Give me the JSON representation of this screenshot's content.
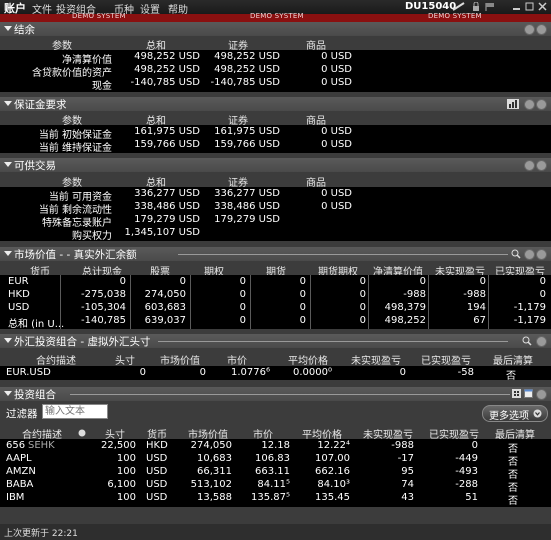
{
  "titlebar": {
    "title": "账户",
    "menu": [
      "文件",
      "投资组合",
      "币种",
      "设置",
      "帮助"
    ],
    "account": "DU15040"
  },
  "demo_labels": [
    "DEMO SYSTEM",
    "DEMO SYSTEM",
    "DEMO SYSTEM"
  ],
  "summary": {
    "title": "结余",
    "headers": [
      "参数",
      "总和",
      "证券",
      "商品"
    ],
    "rows": [
      [
        "净清算价值",
        "498,252 USD",
        "498,252 USD",
        "0 USD"
      ],
      [
        "含贷款价值的资产",
        "498,252 USD",
        "498,252 USD",
        "0 USD"
      ],
      [
        "现金",
        "-140,785 USD",
        "-140,785 USD",
        "0 USD"
      ]
    ]
  },
  "margin": {
    "title": "保证金要求",
    "headers": [
      "参数",
      "总和",
      "证券",
      "商品"
    ],
    "rows": [
      [
        "当前 初始保证金",
        "161,975 USD",
        "161,975 USD",
        "0 USD"
      ],
      [
        "当前 维持保证金",
        "159,766 USD",
        "159,766 USD",
        "0 USD"
      ]
    ]
  },
  "available": {
    "title": "可供交易",
    "headers": [
      "参数",
      "总和",
      "证券",
      "商品"
    ],
    "rows": [
      [
        "当前 可用资金",
        "336,277 USD",
        "336,277 USD",
        "0 USD"
      ],
      [
        "当前 剩余流动性",
        "338,486 USD",
        "338,486 USD",
        "0 USD"
      ],
      [
        "特殊备忘录账户",
        "179,279 USD",
        "179,279 USD",
        ""
      ],
      [
        "购买权力",
        "1,345,107 USD",
        "",
        ""
      ]
    ]
  },
  "market": {
    "title": "市场价值 - - 真实外汇余额",
    "headers": [
      "货币",
      "总计现金",
      "股票",
      "期权",
      "期货",
      "期货期权",
      "净清算价值",
      "未实现盈亏",
      "已实现盈亏"
    ],
    "rows": [
      [
        "EUR",
        "0",
        "0",
        "0",
        "0",
        "0",
        "0",
        "0",
        "0"
      ],
      [
        "HKD",
        "-275,038",
        "274,050",
        "0",
        "0",
        "0",
        "-988",
        "-988",
        "0"
      ],
      [
        "USD",
        "-105,304",
        "603,683",
        "0",
        "0",
        "0",
        "498,379",
        "194",
        "-1,179"
      ],
      [
        "总和 (in U...",
        "-140,785",
        "639,037",
        "0",
        "0",
        "0",
        "498,252",
        "67",
        "-1,179"
      ]
    ]
  },
  "fx": {
    "title": "外汇投资组合 - 虚拟外汇头寸",
    "headers": [
      "合约描述",
      "头寸",
      "市场价值",
      "市价",
      "平均价格",
      "未实现盈亏",
      "已实现盈亏",
      "最后清算"
    ],
    "rows": [
      [
        "EUR.USD",
        "0",
        "0",
        "1.0776⁶",
        "0.0000⁰",
        "0",
        "-58",
        "否"
      ]
    ]
  },
  "portfolio": {
    "title": "投资组合",
    "filter_label": "过滤器",
    "filter_placeholder": "输入文本",
    "more_options": "更多选项",
    "headers": [
      "合约描述",
      "头寸",
      "货币",
      "市场价值",
      "市价",
      "平均价格",
      "未实现盈亏",
      "已实现盈亏",
      "最后清算"
    ],
    "rows": [
      [
        "656",
        "SEHK",
        "22,500",
        "HKD",
        "274,050",
        "12.18",
        "12.22⁴",
        "-988",
        "0",
        "否"
      ],
      [
        "AAPL",
        "",
        "100",
        "USD",
        "10,683",
        "106.83",
        "107.00",
        "-17",
        "-449",
        "否"
      ],
      [
        "AMZN",
        "",
        "100",
        "USD",
        "66,311",
        "663.11",
        "662.16",
        "95",
        "-493",
        "否"
      ],
      [
        "BABA",
        "",
        "6,100",
        "USD",
        "513,102",
        "84.11⁵",
        "84.10³",
        "74",
        "-288",
        "否"
      ],
      [
        "IBM",
        "",
        "100",
        "USD",
        "13,588",
        "135.87⁵",
        "135.45",
        "43",
        "51",
        "否"
      ]
    ]
  },
  "footer": {
    "last_updated": "上次更新于 22:21"
  }
}
